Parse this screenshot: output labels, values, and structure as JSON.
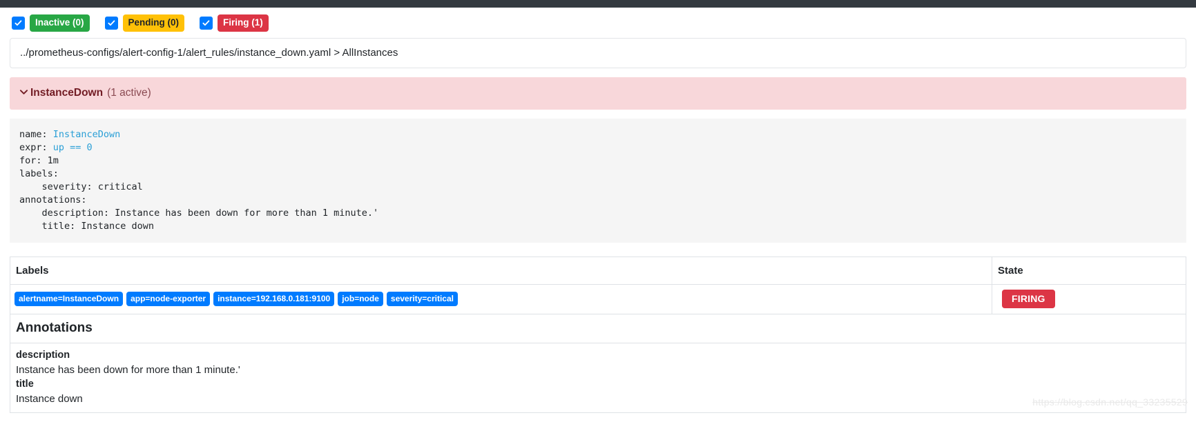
{
  "navbar": {
    "color": "#343a40"
  },
  "filters": [
    {
      "label": "Inactive (0)",
      "style": "success",
      "color": "#28a745",
      "checked": true,
      "icon": "checkbox-checked-icon"
    },
    {
      "label": "Pending (0)",
      "style": "warning",
      "color": "#ffc107",
      "checked": true,
      "icon": "checkbox-checked-icon"
    },
    {
      "label": "Firing (1)",
      "style": "danger",
      "color": "#dc3545",
      "checked": true,
      "icon": "checkbox-checked-icon"
    }
  ],
  "breadcrumb": {
    "text": "../prometheus-configs/alert-config-1/alert_rules/instance_down.yaml > AllInstances"
  },
  "alert_group": {
    "chevron_icon": "chevron-down-icon",
    "name": "InstanceDown",
    "count_text": "(1 active)",
    "background": "#f8d7da",
    "text_color": "#721c24"
  },
  "rule_yaml": {
    "lines": [
      {
        "key": "name: ",
        "value": "InstanceDown",
        "highlight": true
      },
      {
        "key": "expr: ",
        "value": "up == 0",
        "highlight": true
      },
      {
        "key": "for: 1m",
        "value": "",
        "highlight": false
      },
      {
        "key": "labels:",
        "value": "",
        "highlight": false
      },
      {
        "key": "    severity: critical",
        "value": "",
        "highlight": false
      },
      {
        "key": "annotations:",
        "value": "",
        "highlight": false
      },
      {
        "key": "    description: Instance has been down for more than 1 minute.'",
        "value": "",
        "highlight": false
      },
      {
        "key": "    title: Instance down",
        "value": "",
        "highlight": false
      }
    ],
    "raw": "name: InstanceDown\nexpr: up == 0\nfor: 1m\nlabels:\n    severity: critical\nannotations:\n    description: Instance has been down for more than 1 minute.'\n    title: Instance down"
  },
  "table": {
    "headers": {
      "labels": "Labels",
      "state": "State"
    },
    "rows": [
      {
        "labels": [
          "alertname=InstanceDown",
          "app=node-exporter",
          "instance=192.168.0.181:9100",
          "job=node",
          "severity=critical"
        ],
        "state": "FIRING",
        "state_color": "#dc3545"
      }
    ],
    "annotations_heading": "Annotations",
    "annotations": [
      {
        "key": "description",
        "value": "Instance has been down for more than 1 minute.'"
      },
      {
        "key": "title",
        "value": "Instance down"
      }
    ]
  },
  "watermark": {
    "text": "https://blog.csdn.net/qq_33235529"
  }
}
